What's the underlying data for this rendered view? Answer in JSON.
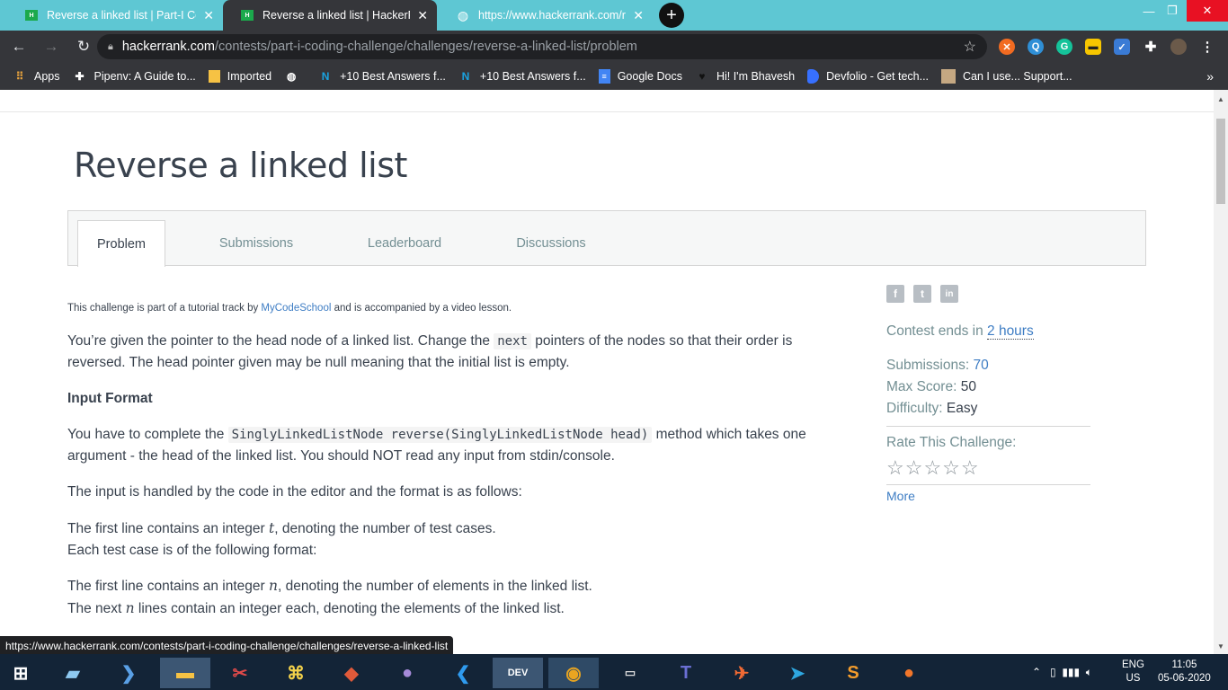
{
  "browser": {
    "tabs": [
      {
        "title": "Reverse a linked list | Part-I Codin",
        "close": "✕"
      },
      {
        "title": "Reverse a linked list | HackerRank",
        "close": "✕"
      },
      {
        "title": "https://www.hackerrank.com/rest",
        "close": "✕"
      }
    ],
    "new_tab": "+",
    "url_domain": "hackerrank.com",
    "url_path": "/contests/part-i-coding-challenge/challenges/reverse-a-linked-list/problem",
    "bookmarks": [
      {
        "label": "Apps",
        "icon": "apps-grid-icon"
      },
      {
        "label": "Pipenv: A Guide to...",
        "icon": "pipenv-icon"
      },
      {
        "label": "Imported",
        "icon": "folder-icon"
      },
      {
        "label": "",
        "icon": "globe-icon"
      },
      {
        "label": "+10 Best Answers f...",
        "icon": "n-icon"
      },
      {
        "label": "+10 Best Answers f...",
        "icon": "n-icon"
      },
      {
        "label": "Google Docs",
        "icon": "docs-icon"
      },
      {
        "label": "Hi! I'm Bhavesh",
        "icon": "heart-icon"
      },
      {
        "label": "Devfolio - Get tech...",
        "icon": "devfolio-icon"
      },
      {
        "label": "Can I use... Support...",
        "icon": "caniuse-icon"
      }
    ],
    "bookmarks_more": "»",
    "status_url": "https://www.hackerrank.com/contests/part-i-coding-challenge/challenges/reverse-a-linked-list"
  },
  "challenge": {
    "title": "Reverse a linked list",
    "tabs": [
      "Problem",
      "Submissions",
      "Leaderboard",
      "Discussions"
    ],
    "intro_pre": "This challenge is part of a tutorial track by ",
    "intro_link": "MyCodeSchool",
    "intro_post": " and is accompanied by a video lesson.",
    "p1_a": "You’re given the pointer to the head node of a linked list. Change the ",
    "p1_code": "next",
    "p1_b": " pointers of the nodes so that their order is reversed. The head pointer given may be null meaning that the initial list is empty.",
    "input_format_heading": "Input Format",
    "p2_a": "You have to complete the ",
    "p2_code": "SinglyLinkedListNode reverse(SinglyLinkedListNode head)",
    "p2_b": " method which takes one argument - the head of the linked list. You should NOT read any input from stdin/console.",
    "p3": "The input is handled by the code in the editor and the format is as follows:",
    "p4_a": "The first line contains an integer ",
    "p4_var": "t",
    "p4_b": ", denoting the number of test cases.",
    "p4_c": "Each test case is of the following format:",
    "p5_a": "The first line contains an integer ",
    "p5_var": "n",
    "p5_b": ", denoting the number of elements in the linked list.",
    "p6_a": "The next ",
    "p6_var": "n",
    "p6_b": " lines contain an integer each, denoting the elements of the linked list."
  },
  "sidebar": {
    "contest_ends_label": "Contest ends in ",
    "contest_ends_value": "2 hours",
    "submissions_label": "Submissions: ",
    "submissions_value": "70",
    "max_score_label": "Max Score: ",
    "max_score_value": "50",
    "difficulty_label": "Difficulty: ",
    "difficulty_value": "Easy",
    "rate_label": "Rate This Challenge:",
    "stars": "☆☆☆☆☆",
    "more": "More",
    "social": [
      "f",
      "t",
      "in"
    ]
  },
  "taskbar": {
    "lang": "ENG",
    "region": "US",
    "time": "11:05",
    "date": "05-06-2020",
    "dev_label": "DEV"
  }
}
